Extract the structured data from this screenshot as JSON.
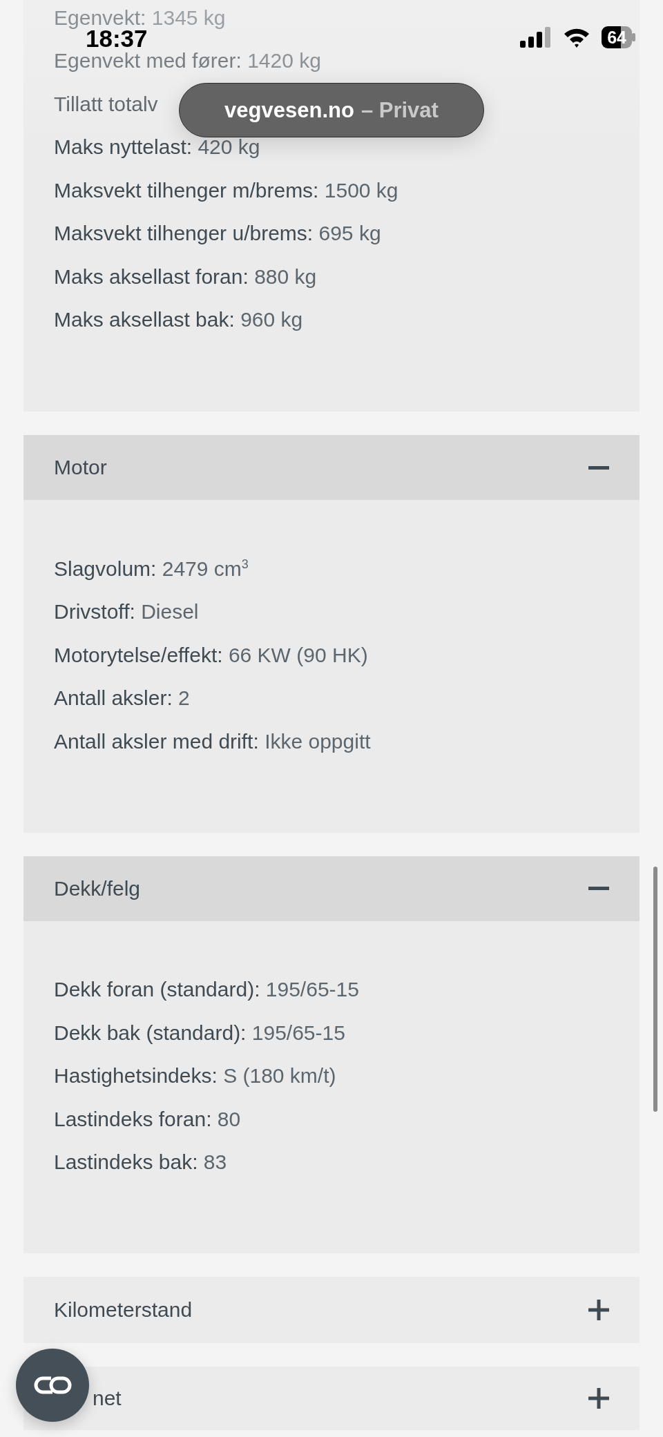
{
  "status_bar": {
    "time": "18:37",
    "battery": "64"
  },
  "site_banner": {
    "domain": "vegvesen.no",
    "mode": "– Privat"
  },
  "partial_section": {
    "rows": [
      {
        "label": "Egenvekt:",
        "value": "1345 kg"
      },
      {
        "label": "Egenvekt med fører:",
        "value": "1420 kg"
      },
      {
        "label": "Tillatt totalv"
      },
      {
        "label": "Maks nyttelast:",
        "value": "420 kg"
      },
      {
        "label": "Maksvekt tilhenger m/brems:",
        "value": "1500 kg"
      },
      {
        "label": "Maksvekt tilhenger u/brems:",
        "value": "695 kg"
      },
      {
        "label": "Maks aksellast foran:",
        "value": "880 kg"
      },
      {
        "label": "Maks aksellast bak:",
        "value": "960 kg"
      }
    ]
  },
  "sections": [
    {
      "title": "Motor",
      "expanded": true,
      "rows": [
        {
          "label": "Slagvolum:",
          "value": "2479 cm$^{3}$"
        },
        {
          "label": "Drivstoff:",
          "value": "Diesel"
        },
        {
          "label": "Motorytelse/effekt:",
          "value": "66 KW (90 HK)"
        },
        {
          "label": "Antall aksler:",
          "value": "2"
        },
        {
          "label": "Antall aksler med drift:",
          "value": "Ikke oppgitt"
        }
      ]
    },
    {
      "title": "Dekk/felg",
      "expanded": true,
      "rows": [
        {
          "label": "Dekk foran (standard):",
          "value": "195/65-15"
        },
        {
          "label": "Dekk bak (standard):",
          "value": "195/65-15"
        },
        {
          "label": "Hastighetsindeks:",
          "value": "S (180 km/t)"
        },
        {
          "label": "Lastindeks foran:",
          "value": "80"
        },
        {
          "label": "Lastindeks bak:",
          "value": "83"
        }
      ]
    },
    {
      "title": "Kilometerstand",
      "expanded": false
    },
    {
      "title": "net",
      "expanded": false
    }
  ]
}
